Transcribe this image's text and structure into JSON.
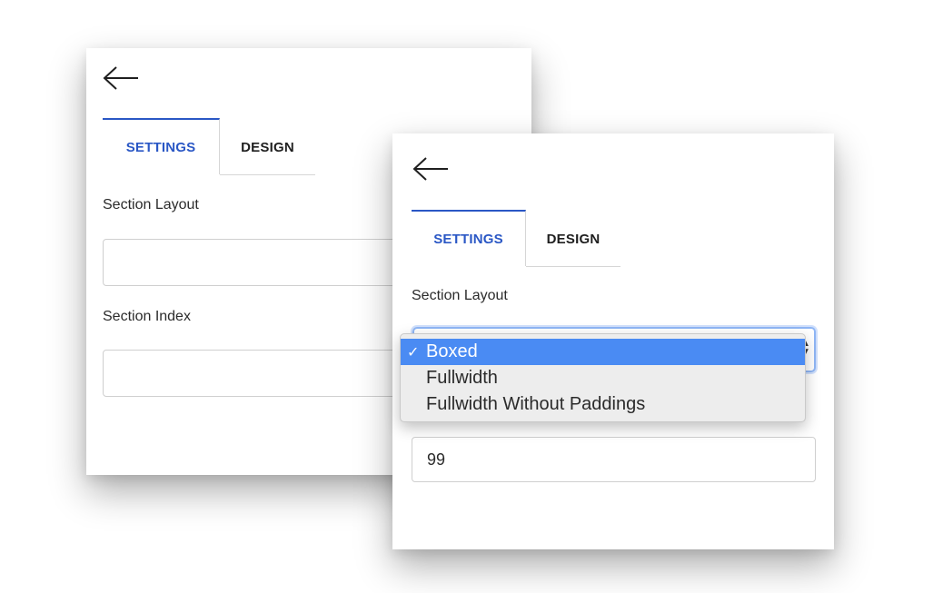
{
  "back_panel": {
    "tabs": [
      "SETTINGS",
      "DESIGN"
    ],
    "section_layout_label": "Section Layout",
    "section_index_label": "Section Index"
  },
  "front_panel": {
    "tabs": [
      "SETTINGS",
      "DESIGN"
    ],
    "section_layout_label": "Section Layout",
    "section_index_value": "99",
    "dropdown": {
      "options": [
        {
          "label": "Boxed",
          "selected": true
        },
        {
          "label": "Fullwidth",
          "selected": false
        },
        {
          "label": "Fullwidth Without Paddings",
          "selected": false
        }
      ],
      "check_mark": "✓"
    }
  },
  "colors": {
    "accent": "#2a57c5",
    "selected_option": "#4a8bf3",
    "menu_bg": "#ededed"
  },
  "icons": [
    "arrow-left-icon",
    "select-arrows-icon"
  ]
}
